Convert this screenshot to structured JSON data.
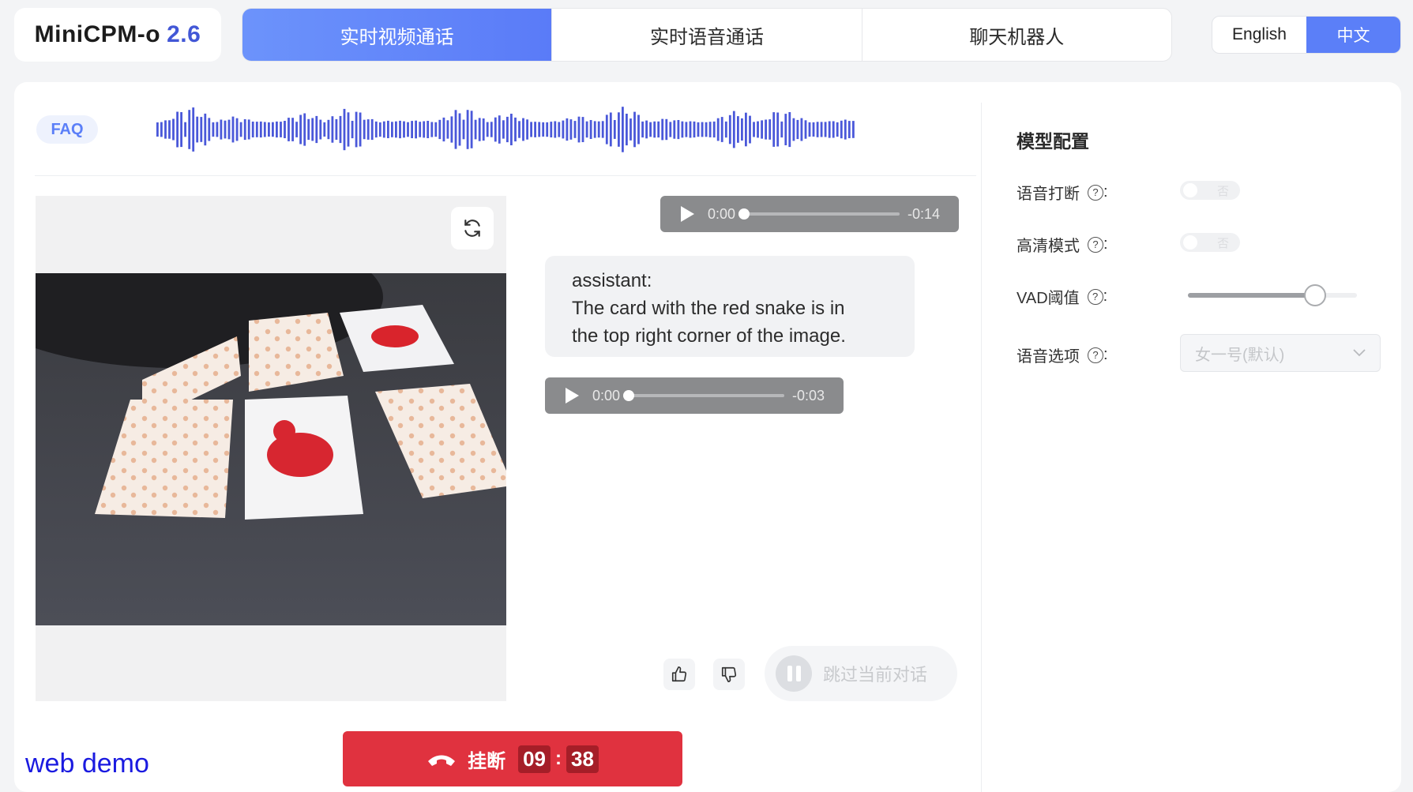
{
  "brand": {
    "name": "MiniCPM-o",
    "version": "2.6"
  },
  "tabs": [
    {
      "label": "实时视频通话",
      "active": true
    },
    {
      "label": "实时语音通话",
      "active": false
    },
    {
      "label": "聊天机器人",
      "active": false
    }
  ],
  "language": {
    "english": "English",
    "chinese": "中文",
    "selected": "中文"
  },
  "faq_label": "FAQ",
  "audio_players": [
    {
      "current": "0:00",
      "remaining": "-0:14"
    },
    {
      "current": "0:00",
      "remaining": "-0:03"
    }
  ],
  "assistant_message": {
    "speaker": "assistant:",
    "lines": [
      "The card with the red snake is in",
      "the top right corner of the image."
    ]
  },
  "skip_button": "跳过当前对话",
  "hangup": {
    "label": "挂断",
    "minutes": "09",
    "seconds": "38",
    "separator": ":"
  },
  "footer_label": "web demo",
  "config": {
    "title": "模型配置",
    "voice_interrupt": {
      "label": "语音打断",
      "state": "否"
    },
    "hd_mode": {
      "label": "高清模式",
      "state": "否"
    },
    "vad": {
      "label": "VAD阈值",
      "value": 0.75
    },
    "voice_option": {
      "label": "语音选项",
      "value": "女一号(默认)"
    }
  },
  "colors": {
    "accent": "#5b7ff8",
    "hangup": "#e0323f",
    "wave": "#4a58d9"
  }
}
